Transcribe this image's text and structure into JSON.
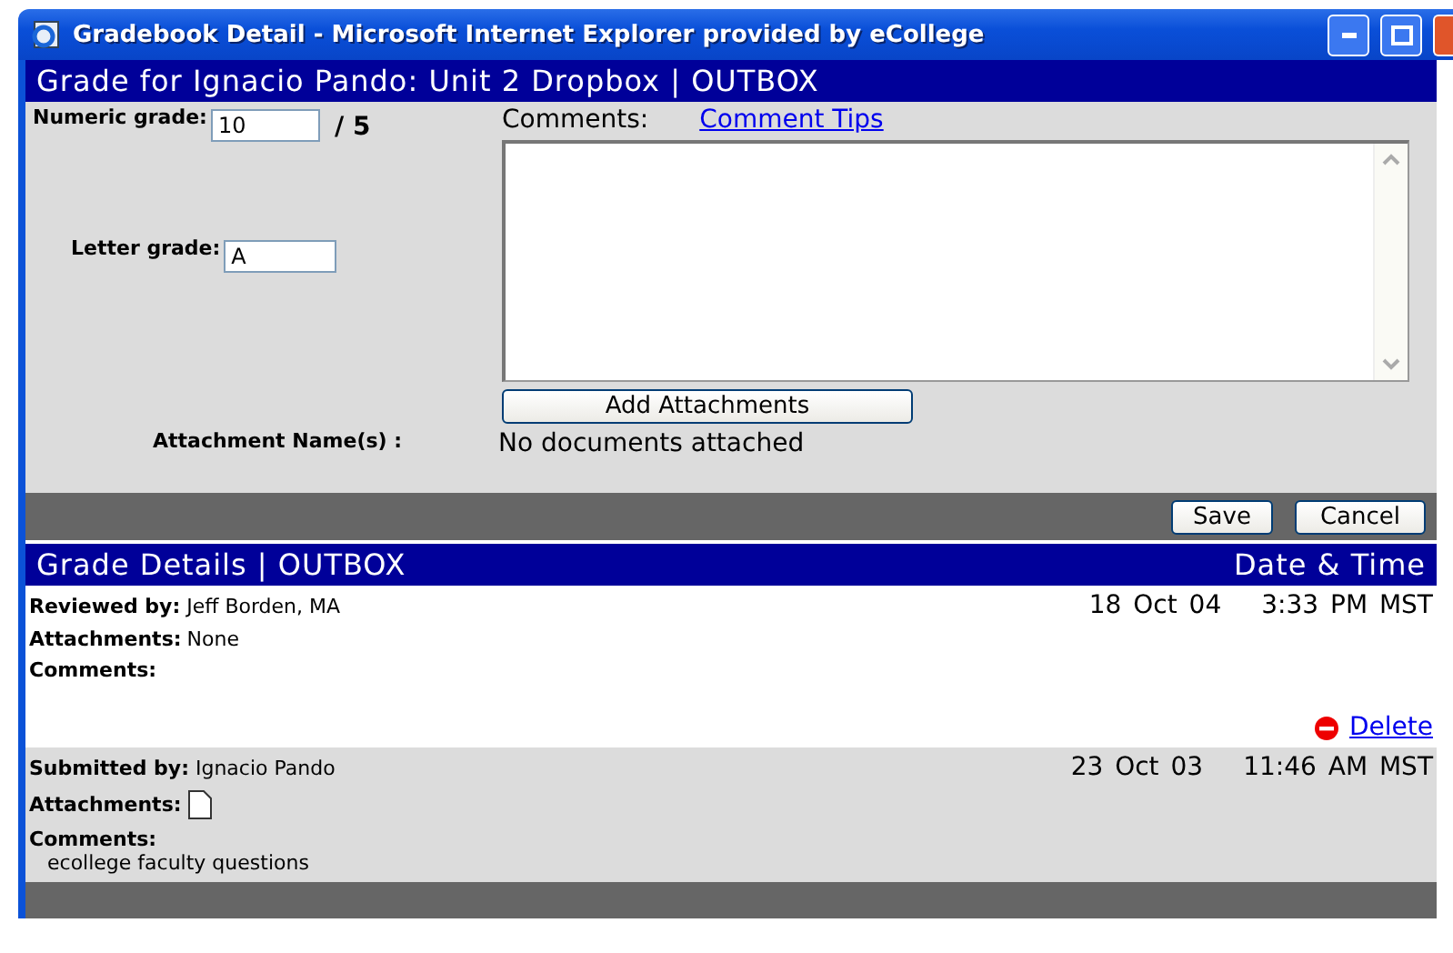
{
  "window": {
    "title": "Gradebook Detail - Microsoft Internet Explorer provided by eCollege"
  },
  "form": {
    "heading": "Grade for Ignacio Pando: Unit 2 Dropbox | OUTBOX",
    "numeric_label": "Numeric grade:",
    "numeric_value": "10",
    "out_of": "/ 5",
    "letter_label": "Letter grade:",
    "letter_value": "A",
    "comments_label": "Comments:",
    "comment_tips": "Comment Tips",
    "add_attachments": "Add Attachments",
    "attachment_label": "Attachment Name(s) :",
    "attachment_value": "No documents attached",
    "buttons": [
      "Save",
      "Cancel"
    ]
  },
  "details": {
    "heading": "Grade Details | OUTBOX",
    "date_heading": "Date & Time",
    "entries": [
      {
        "kind": "review",
        "person_label": "Reviewed by:",
        "person": "Jeff Borden, MA",
        "date": "18 Oct 04",
        "time": "3:33 PM MST",
        "attachments_label": "Attachments:",
        "attachments": "None",
        "comments_label": "Comments:",
        "delete": "Delete"
      },
      {
        "kind": "submission",
        "person_label": "Submitted by:",
        "person": "Ignacio Pando",
        "date": "23 Oct 03",
        "time": "11:46 AM MST",
        "attachments_label": "Attachments:",
        "comments_label": "Comments:",
        "comment": "ecollege faculty questions"
      }
    ]
  }
}
